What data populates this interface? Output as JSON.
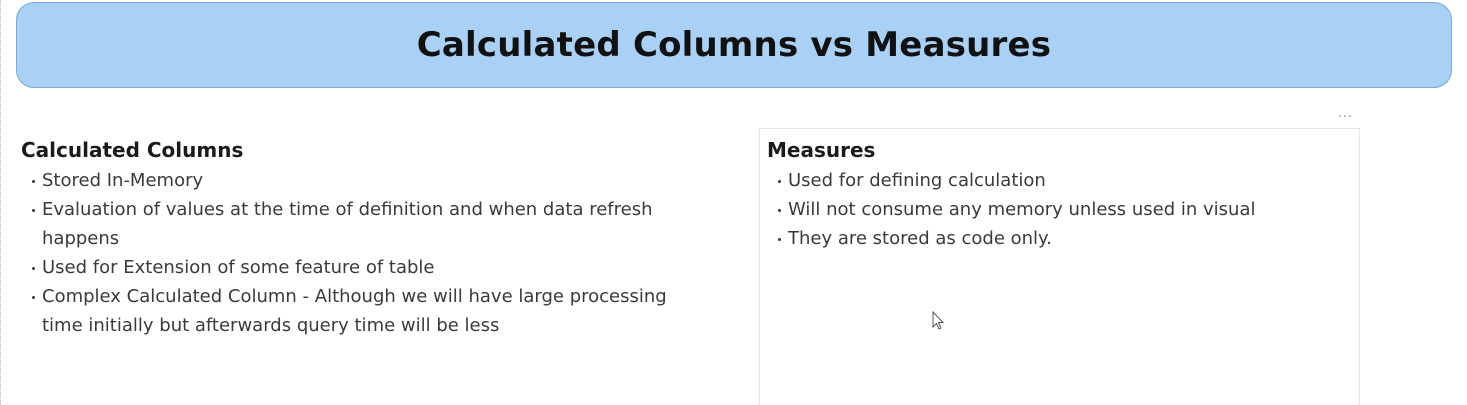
{
  "header": {
    "title": "Calculated Columns vs Measures"
  },
  "visual_header": {
    "more_options_label": "..."
  },
  "calculated_columns": {
    "heading": "Calculated Columns",
    "items": [
      "Stored In-Memory",
      "Evaluation of values at the time of definition and when data refresh happens",
      "Used for Extension of some feature of table",
      "Complex Calculated Column - Although we will have large processing time initially but afterwards query time will be less"
    ]
  },
  "measures": {
    "heading": "Measures",
    "items": [
      "Used for defining calculation",
      "Will not consume any memory unless used in visual",
      "They are stored as code only."
    ]
  },
  "colors": {
    "banner_fill": "#a9d0f5",
    "banner_border": "#7aa8d6",
    "text": "#3a3a3a"
  },
  "icons": {
    "cursor": "mouse-pointer-icon",
    "more": "more-options-icon"
  }
}
